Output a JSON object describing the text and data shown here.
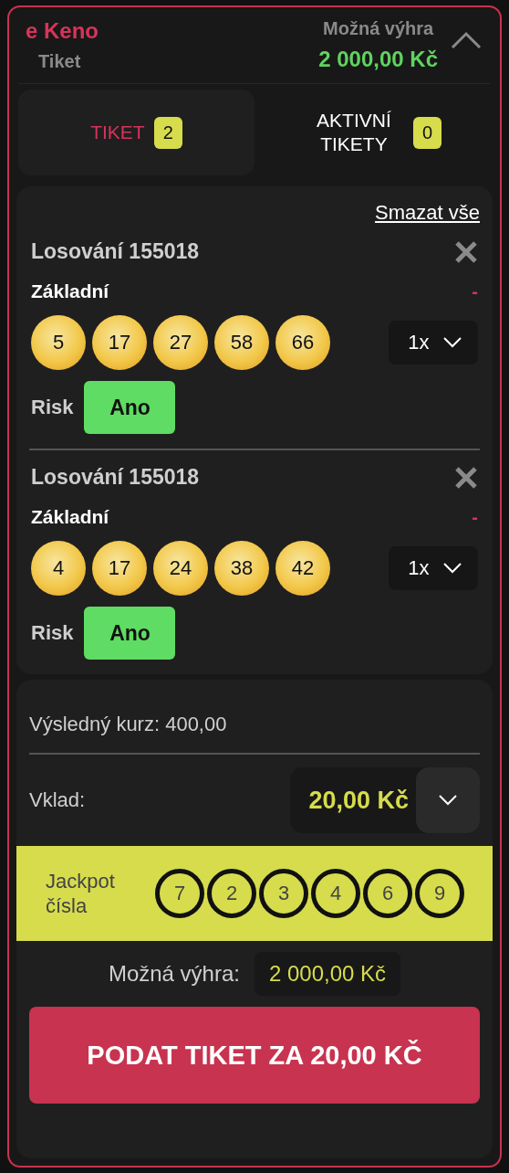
{
  "header": {
    "brand": "e Keno",
    "subtitle": "Tiket",
    "win_label": "Možná výhra",
    "win_amount": "2 000,00 Kč",
    "expanded": true
  },
  "tabs": [
    {
      "label": "TIKET",
      "count": "2",
      "selected": true
    },
    {
      "label": "AKTIVNÍ TIKETY",
      "count": "0",
      "selected": false
    }
  ],
  "clear_all": "Smazat vše",
  "tickets": [
    {
      "draw": "Losování 155018",
      "type": "Základní",
      "odds": "-",
      "numbers": [
        "5",
        "17",
        "27",
        "58",
        "66"
      ],
      "multiplier": "1x",
      "risk_label": "Risk",
      "risk_value": "Ano",
      "risk_on": true
    },
    {
      "draw": "Losování 155018",
      "type": "Základní",
      "odds": "-",
      "numbers": [
        "4",
        "17",
        "24",
        "38",
        "42"
      ],
      "multiplier": "1x",
      "risk_label": "Risk",
      "risk_value": "Ano",
      "risk_on": true
    }
  ],
  "summary": {
    "odds_text": "Výsledný kurz: 400,00",
    "stake_label": "Vklad:",
    "stake_value": "20,00 Kč",
    "jackpot_label": "Jackpot čísla",
    "jackpot_numbers": [
      "7",
      "2",
      "3",
      "4",
      "6",
      "9"
    ],
    "win_label": "Možná výhra:",
    "win_value": "2 000,00 Kč",
    "submit": "PODAT TIKET ZA 20,00 KČ"
  }
}
